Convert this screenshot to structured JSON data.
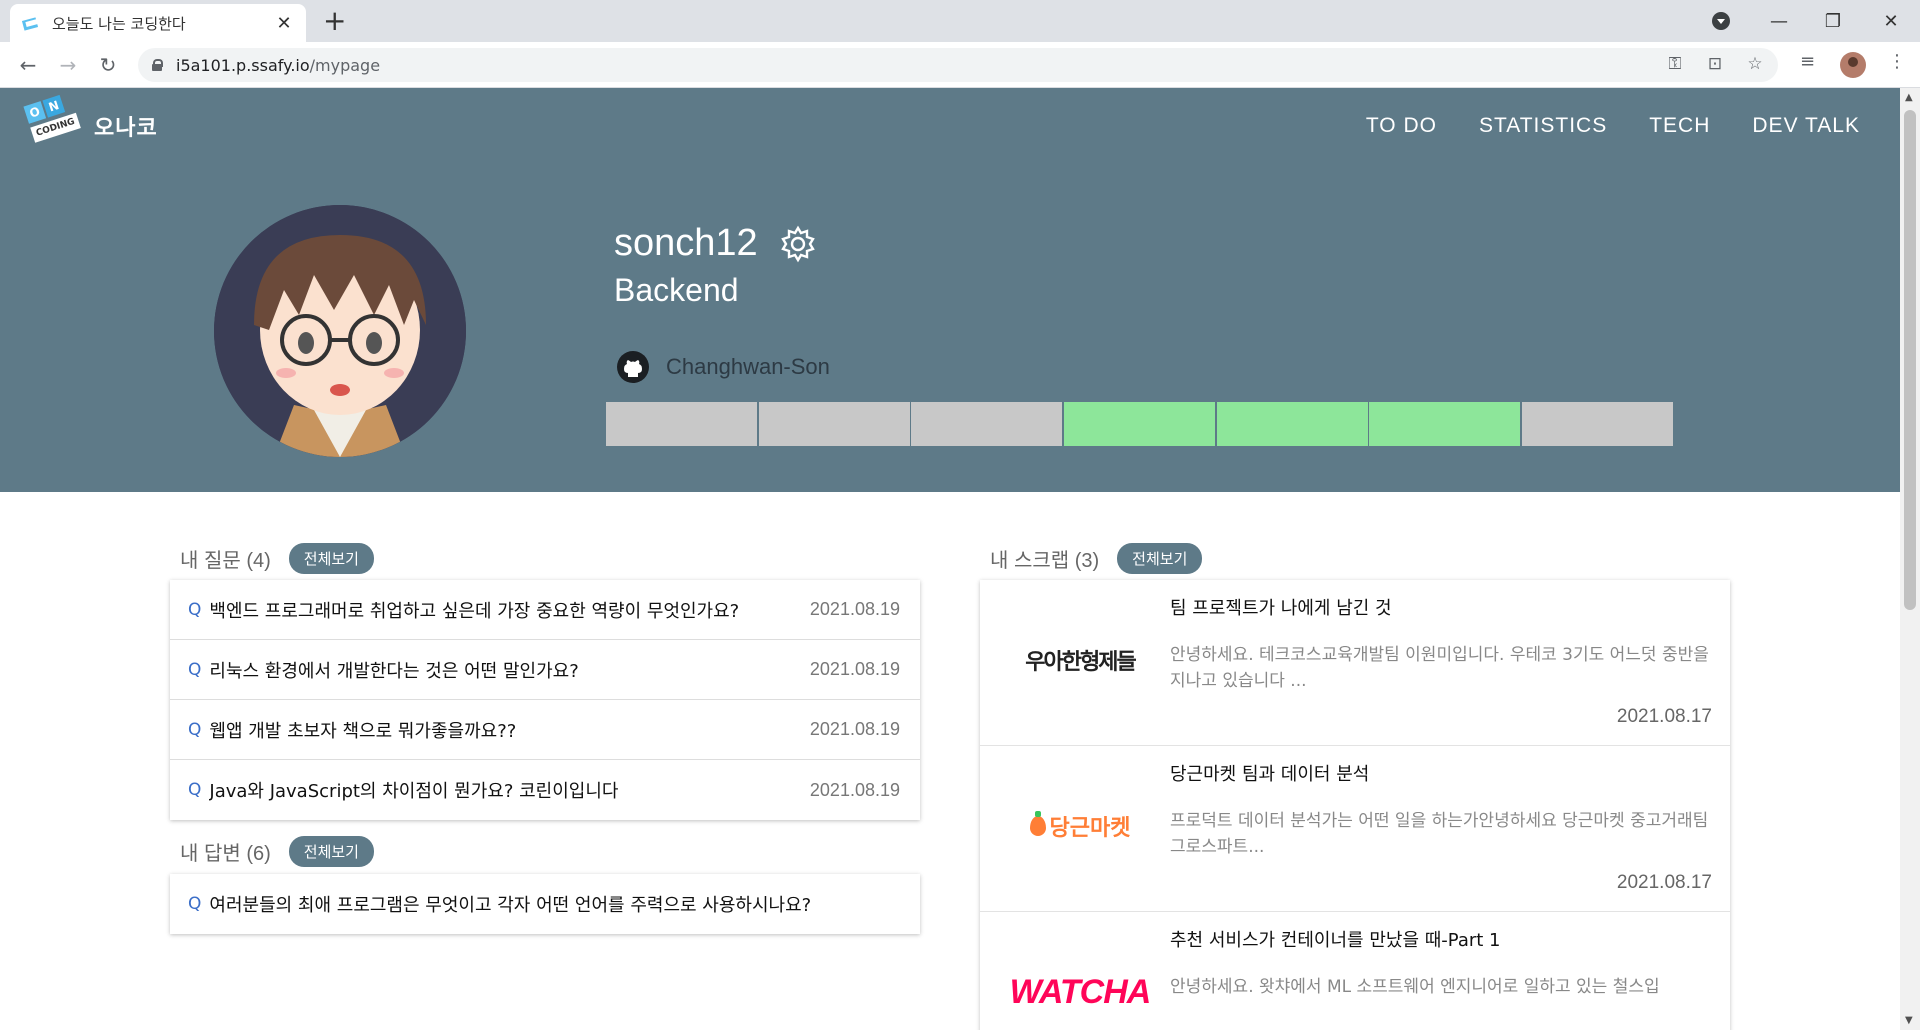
{
  "browser": {
    "tab_title": "오늘도 나는 코딩한다",
    "url_host": "i5a101.p.ssafy.io",
    "url_path": "/mypage"
  },
  "header": {
    "logo_text": "오나코",
    "logo_badge_top": "ON",
    "logo_badge_bottom": "CODING",
    "nav": [
      "TO DO",
      "STATISTICS",
      "TECH",
      "DEV TALK"
    ]
  },
  "profile": {
    "username": "sonch12",
    "role": "Backend",
    "github": "Changhwan-Son",
    "streak": [
      false,
      false,
      false,
      true,
      true,
      true,
      false
    ],
    "colors": {
      "hero_bg": "#5e7a88",
      "streak_on": "#8de69a",
      "streak_off": "#c8c8c8"
    }
  },
  "questions": {
    "title": "내 질문 (4)",
    "view_all": "전체보기",
    "q_marker": "Q",
    "items": [
      {
        "title": "백엔드 프로그래머로 취업하고 싶은데 가장 중요한 역량이 무엇인가요?",
        "date": "2021.08.19"
      },
      {
        "title": "리눅스 환경에서 개발한다는 것은 어떤 말인가요?",
        "date": "2021.08.19"
      },
      {
        "title": "웹앱 개발 초보자 책으로 뭐가좋을까요??",
        "date": "2021.08.19"
      },
      {
        "title": "Java와 JavaScript의 차이점이 뭔가요? 코린이입니다",
        "date": "2021.08.19"
      }
    ]
  },
  "answers": {
    "title": "내 답변 (6)",
    "view_all": "전체보기",
    "items": [
      {
        "title": "여러분들의 최애 프로그램은 무엇이고 각자 어떤 언어를 주력으로 사용하시나요?"
      }
    ]
  },
  "scraps": {
    "title": "내 스크랩 (3)",
    "view_all": "전체보기",
    "items": [
      {
        "brand": "우아한형제들",
        "title": "팀 프로젝트가 나에게 남긴 것",
        "desc": "안녕하세요. 테크코스교육개발팀 이원미입니다. 우테코 3기도 어느덧 중반을 지나고 있습니다 ...",
        "date": "2021.08.17"
      },
      {
        "brand": "당근마켓",
        "title": "당근마켓 팀과 데이터 분석",
        "desc": "프로덕트 데이터 분석가는 어떤 일을 하는가안녕하세요 당근마켓 중고거래팀 그로스파트...",
        "date": "2021.08.17"
      },
      {
        "brand": "WATCHA",
        "title": "추천 서비스가 컨테이너를 만났을 때-Part 1",
        "desc": "안녕하세요. 왓챠에서 ML 소프트웨어 엔지니어로 일하고 있는 철스입",
        "date": ""
      }
    ]
  }
}
